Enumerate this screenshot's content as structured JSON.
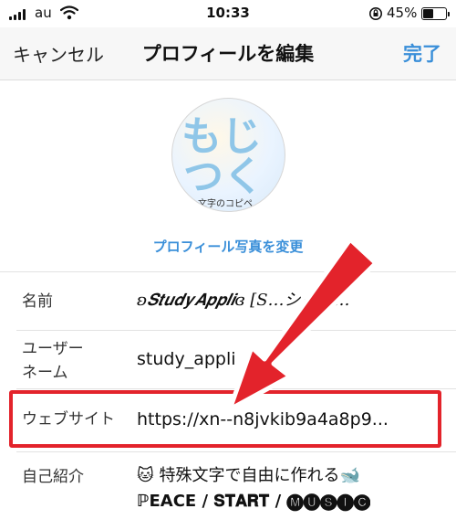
{
  "status_bar": {
    "carrier": "au",
    "time": "10:33",
    "battery_percent": "45%",
    "battery_level": 0.45,
    "icons": [
      "signal-icon",
      "wifi-icon",
      "orientation-lock-icon",
      "battery-icon"
    ]
  },
  "nav": {
    "cancel_label": "キャンセル",
    "title": "プロフィールを編集",
    "done_label": "完了"
  },
  "avatar": {
    "logo_text_top": "もじ",
    "logo_text_bottom": "つく",
    "logo_caption": "文字のコピペ",
    "change_photo_label": "プロフィール写真を変更"
  },
  "fields": {
    "name_label": "名前",
    "name_value": "ʚ𝑺𝒕𝒖𝒅𝒚𝑨𝒑𝒑𝒍𝒊ɞ [S…シャレ…",
    "username_label_line1": "ユーザー",
    "username_label_line2": "ネーム",
    "username_value": "study_appli",
    "website_label": "ウェブサイト",
    "website_value": "https://xn--n8jvkib9a4a8p9...",
    "bio_label": "自己紹介",
    "bio_line1": "🐱 特殊文字で自由に作れる🐋",
    "bio_line2": "ℙEACE / 𝐒𝐓𝐀𝐑𝐓 / 🅜🅤🅢🅘🅒"
  },
  "colors": {
    "accent": "#3a8fd9",
    "highlight": "#e3232b",
    "nav_background": "#f7f7f7"
  }
}
